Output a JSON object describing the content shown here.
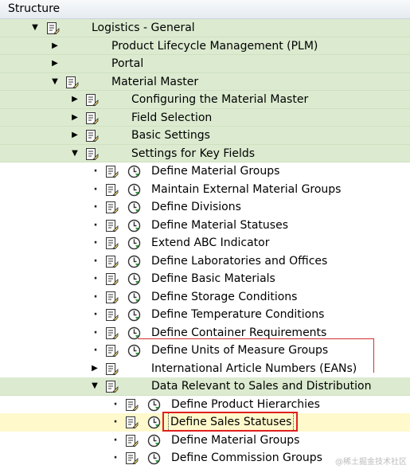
{
  "header": {
    "title": "Structure"
  },
  "tree": {
    "logistics": "Logistics - General",
    "plm": "Product Lifecycle Management (PLM)",
    "portal": "Portal",
    "material_master": "Material Master",
    "configuring": "Configuring the Material Master",
    "field_selection": "Field Selection",
    "basic_settings": "Basic Settings",
    "key_fields": "Settings for Key Fields",
    "items": [
      "Define Material Groups",
      "Maintain External Material Groups",
      "Define Divisions",
      "Define Material Statuses",
      "Extend ABC Indicator",
      "Define Laboratories and Offices",
      "Define Basic Materials",
      "Define Storage Conditions",
      "Define Temperature Conditions",
      "Define Container Requirements",
      "Define Units of Measure Groups"
    ],
    "eans": "International Article Numbers (EANs)",
    "sales_dist": "Data Relevant to Sales and Distribution",
    "sd_items": [
      "Define Product Hierarchies",
      "Define Sales Statuses",
      "Define Material Groups",
      "Define Commission Groups"
    ]
  },
  "watermark": "@稀土掘金技术社区"
}
